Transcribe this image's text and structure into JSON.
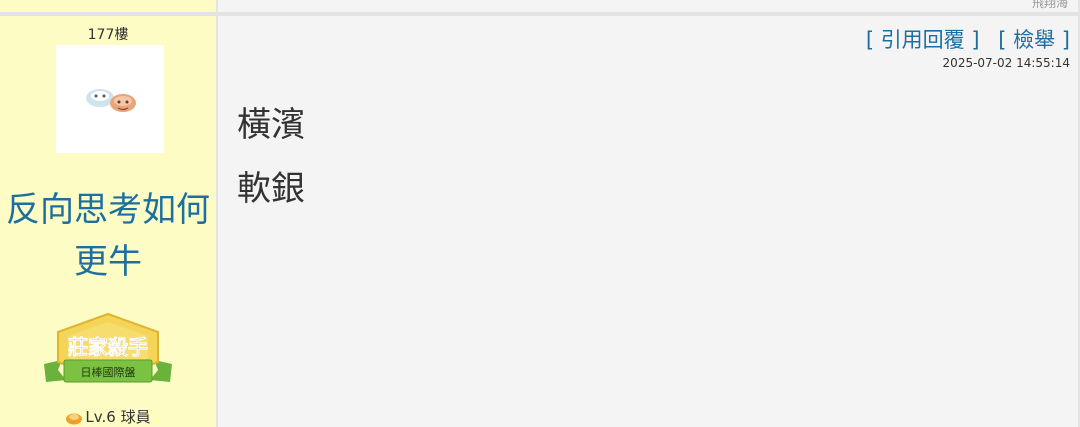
{
  "prev_post": {
    "signature": "飛翔海"
  },
  "post": {
    "floor": "177樓",
    "nickname": "反向思考如何更牛",
    "badge": {
      "title": "莊家殺手",
      "subtitle": "日棒國際盤"
    },
    "level": "Lv.6 球員",
    "actions": {
      "quote_reply": "[ 引用回覆 ]",
      "report": "[ 檢舉 ]"
    },
    "timestamp": "2025-07-02 14:55:14",
    "body_lines": [
      "橫濱",
      "軟銀"
    ]
  },
  "colors": {
    "sidebar_bg": "#fdfcc4",
    "content_bg": "#f4f4f4",
    "accent": "#1d6fa1"
  }
}
